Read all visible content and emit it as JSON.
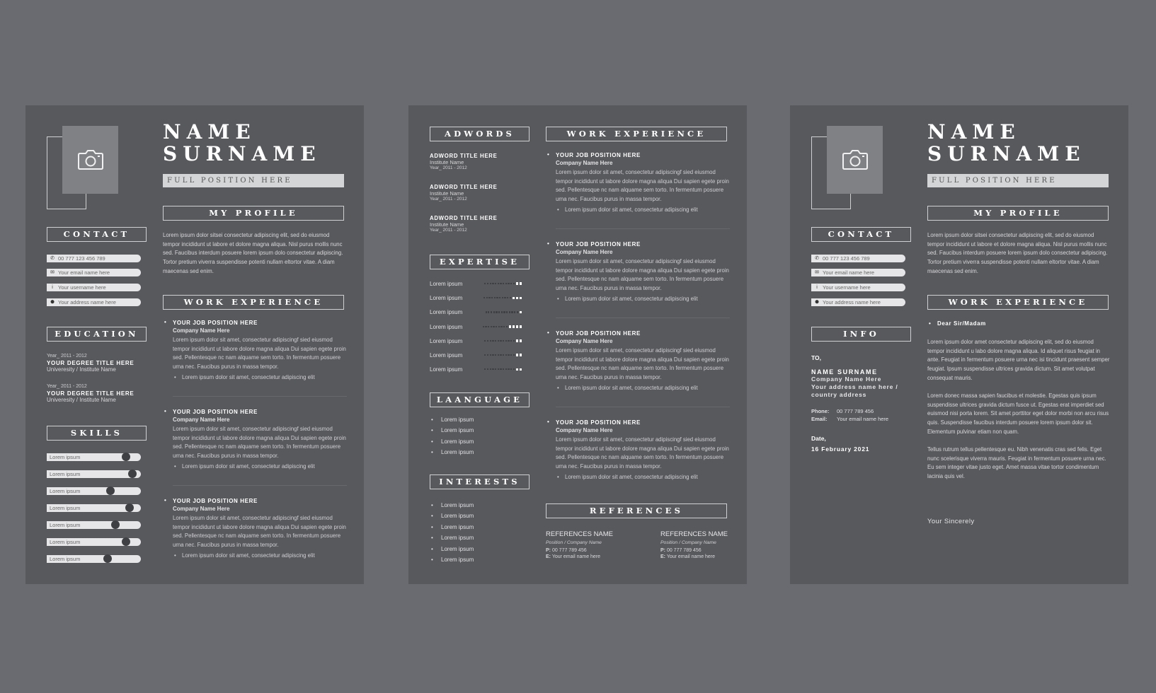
{
  "colors": {
    "background": "#6a6b70",
    "page": "#58595d",
    "photo": "#808184",
    "accent_light": "#d4d5d7"
  },
  "resume1": {
    "name_line1": "NAME",
    "name_line2": "SURNAME",
    "position": "FULL POSITION HERE",
    "contact_heading": "CONTACT",
    "contact": [
      {
        "icon": "phone-icon",
        "glyph": "✆",
        "text": "00 777 123 456 789"
      },
      {
        "icon": "email-icon",
        "glyph": "✉",
        "text": "Your email name here"
      },
      {
        "icon": "user-icon",
        "glyph": "i",
        "text": "Your username here"
      },
      {
        "icon": "location-icon",
        "glyph": "⬤",
        "text": "Your address name here"
      }
    ],
    "education_heading": "EDUCATION",
    "education": [
      {
        "year": "Year_ 2011 - 2012",
        "degree": "YOUR DEGREE TITLE HERE",
        "institute": "Univeresity / Institute Name"
      },
      {
        "year": "Year_ 2011 - 2012",
        "degree": "YOUR DEGREE TITLE HERE",
        "institute": "Univeresity / Institute Name"
      }
    ],
    "skills_heading": "SKILLS",
    "skills": [
      {
        "label": "Lorem ipsum",
        "level": 0.84
      },
      {
        "label": "Lorem ipsum",
        "level": 0.91
      },
      {
        "label": "Lorem ipsum",
        "level": 0.68
      },
      {
        "label": "Lorem ipsum",
        "level": 0.88
      },
      {
        "label": "Lorem ipsum",
        "level": 0.73
      },
      {
        "label": "Lorem ipsum",
        "level": 0.84
      },
      {
        "label": "Lorem ipsum",
        "level": 0.65
      }
    ],
    "profile_heading": "MY PROFILE",
    "profile_text": "Lorem ipsum dolor sitsei consectetur adipiscing elit, sed do eiusmod tempor incididunt ut labore et dolore magna aliqua. Nisl purus mollis nunc sed. Faucibus interdum posuere lorem ipsum dolo consectetur adipiscing. Tortor pretium viverra suspendisse potenti nullam eltortor vitae. A diam maecenas sed enim.",
    "work_heading": "WORK EXPERIENCE",
    "jobs": [
      {
        "title": "YOUR JOB POSITION HERE",
        "company": "Company Name Here",
        "desc": "Lorem ipsum dolor sit amet, consectetur adipiscingf sied eiusmod tempor incididunt ut labore dolore magna aliqua Dui sapien egete proin sed. Pellentesque nc nam alquame sem torto. In fermentum posuere urna nec. Faucibus purus in massa tempor.",
        "bullet": "Lorem ipsum dolor sit amet, consectetur adipiscing elit"
      },
      {
        "title": "YOUR JOB POSITION HERE",
        "company": "Company Name Here",
        "desc": "Lorem ipsum dolor sit amet, consectetur adipiscingf sied eiusmod tempor incididunt ut labore dolore magna aliqua Dui sapien egete proin sed. Pellentesque nc nam alquame sem torto. In fermentum posuere urna nec. Faucibus purus in massa tempor.",
        "bullet": "Lorem ipsum dolor sit amet, consectetur adipiscing elit"
      },
      {
        "title": "YOUR JOB POSITION HERE",
        "company": "Company Name Here",
        "desc": "Lorem ipsum dolor sit amet, consectetur adipiscingf sied eiusmod tempor incididunt ut labore dolore magna aliqua Dui sapien egete proin sed. Pellentesque nc nam alquame sem torto. In fermentum posuere urna nec. Faucibus purus in massa tempor.",
        "bullet": "Lorem ipsum dolor sit amet, consectetur adipiscing elit"
      }
    ]
  },
  "resume2": {
    "adwords_heading": "ADWORDS",
    "adwords": [
      {
        "title": "ADWORD TITLE HERE",
        "institute": "Institute Name",
        "year": "Year_ 2011 - 2012"
      },
      {
        "title": "ADWORD TITLE HERE",
        "institute": "Institute Name",
        "year": "Year_ 2011 - 2012"
      },
      {
        "title": "ADWORD TITLE HERE",
        "institute": "Institute Name",
        "year": "Year_ 2011 - 2012"
      }
    ],
    "expertise_heading": "EXPERTISE",
    "expertise": [
      {
        "label": "Lorem ipsum",
        "filled_dots": 2
      },
      {
        "label": "Lorem ipsum",
        "filled_dots": 3
      },
      {
        "label": "Lorem ipsum",
        "filled_dots": 1
      },
      {
        "label": "Lorem ipsum",
        "filled_dots": 4
      },
      {
        "label": "Lorem ipsum",
        "filled_dots": 2
      },
      {
        "label": "Lorem ipsum",
        "filled_dots": 2
      },
      {
        "label": "Lorem ipsum",
        "filled_dots": 2
      }
    ],
    "language_heading": "LAANGUAGE",
    "languages": [
      "Lorem ipsum",
      "Lorem ipsum",
      "Lorem ipsum",
      "Lorem ipsum"
    ],
    "interests_heading": "INTERESTS",
    "interests": [
      "Lorem ipsum",
      "Lorem ipsum",
      "Lorem ipsum",
      "Lorem ipsum",
      "Lorem ipsum",
      "Lorem ipsum"
    ],
    "work_heading": "WORK EXPERIENCE",
    "jobs": [
      {
        "title": "YOUR JOB POSITION HERE",
        "company": "Company Name Here",
        "desc": "Lorem ipsum dolor sit amet, consectetur adipiscingf sied eiusmod tempor incididunt ut labore dolore magna aliqua Dui sapien egete proin sed. Pellentesque nc nam alquame sem torto. In fermentum posuere urna nec. Faucibus purus in massa tempor.",
        "bullet": "Lorem ipsum dolor sit amet, consectetur adipiscing elit"
      },
      {
        "title": "YOUR JOB POSITION HERE",
        "company": "Company Name Here",
        "desc": "Lorem ipsum dolor sit amet, consectetur adipiscingf sied eiusmod tempor incididunt ut labore dolore magna aliqua Dui sapien egete proin sed. Pellentesque nc nam alquame sem torto. In fermentum posuere urna nec. Faucibus purus in massa tempor.",
        "bullet": "Lorem ipsum dolor sit amet, consectetur adipiscing elit"
      },
      {
        "title": "YOUR JOB POSITION HERE",
        "company": "Company Name Here",
        "desc": "Lorem ipsum dolor sit amet, consectetur adipiscingf sied eiusmod tempor incididunt ut labore dolore magna aliqua Dui sapien egete proin sed. Pellentesque nc nam alquame sem torto. In fermentum posuere urna nec. Faucibus purus in massa tempor.",
        "bullet": "Lorem ipsum dolor sit amet, consectetur adipiscing elit"
      },
      {
        "title": "YOUR JOB POSITION HERE",
        "company": "Company Name Here",
        "desc": "Lorem ipsum dolor sit amet, consectetur adipiscingf sied eiusmod tempor incididunt ut labore dolore magna aliqua Dui sapien egete proin sed. Pellentesque nc nam alquame sem torto. In fermentum posuere urna nec. Faucibus purus in massa tempor.",
        "bullet": "Lorem ipsum dolor sit amet, consectetur adipiscing elit"
      }
    ],
    "references_heading": "REFERENCES",
    "references": [
      {
        "name": "REFERENCES NAME",
        "position": "Position / Company Name",
        "phone_label": "P:",
        "phone": "00 777 789 456",
        "email_label": "E:",
        "email": "Your email name here"
      },
      {
        "name": "REFERENCES NAME",
        "position": "Position / Company Name",
        "phone_label": "P:",
        "phone": "00 777 789 456",
        "email_label": "E:",
        "email": "Your email name here"
      }
    ]
  },
  "letter": {
    "name_line1": "NAME",
    "name_line2": "SURNAME",
    "position": "FULL POSITION HERE",
    "contact_heading": "CONTACT",
    "contact": [
      {
        "icon": "phone-icon",
        "glyph": "✆",
        "text": "00 777 123 456 789"
      },
      {
        "icon": "email-icon",
        "glyph": "✉",
        "text": "Your email name here"
      },
      {
        "icon": "user-icon",
        "glyph": "i",
        "text": "Your username here"
      },
      {
        "icon": "location-icon",
        "glyph": "⬤",
        "text": "Your address name here"
      }
    ],
    "info_heading": "INFO",
    "to_label": "TO,",
    "recipient_name": "NAME SURNAME",
    "recipient_company": "Company Name Here",
    "recipient_address": "Your address name here / country address",
    "phone_label": "Phone:",
    "phone": "00 777 789 456",
    "email_label": "Email:",
    "email": "Your email name here",
    "date_label": "Date,",
    "date": "16 February 2021",
    "profile_heading": "MY PROFILE",
    "profile_text": "Lorem ipsum dolor sitsei consectetur adipiscing elit, sed do eiusmod tempor incididunt ut labore et dolore magna aliqua. Nisl purus mollis nunc sed. Faucibus interdum posuere lorem ipsum dolo consectetur adipiscing. Tortor pretium viverra suspendisse potenti nullam eltortor vitae. A diam maecenas sed enim.",
    "work_heading": "WORK EXPERIENCE",
    "salutation": "Dear Sir/Madam",
    "paragraphs": [
      "Lorem ipsum dolor amet consectetur adipiscing elit, sed do eiusmod tempor incididunt u labo dolore magna aliqua. Id aliquet risus feugiat in ante. Feugiat in fermentum posuere urna nec isi tincidunt praesent semper feugiat. Ipsum suspendisse ultrices gravida dictum. Sit amet volutpat consequat mauris.",
      "Lorem donec massa sapien faucibus et molestie. Egestas quis ipsum suspendisse ultrices gravida dictum fusce ut. Egestas erat imperdiet sed euismod nisi porta lorem. Sit amet porttitor eget dolor morbi non arcu risus quis. Suspendisse faucibus interdum posuere lorem ipsum dolor sit. Elementum pulvinar etiam non quam.",
      "Tellus rutrum tellus pellentesque eu. Nibh venenatis cras sed felis. Eget nunc scelerisque viverra mauris. Feugiat in fermentum posuere urna nec. Eu sem integer vitae justo eget. Amet massa vitae tortor condimentum lacinia quis vel."
    ],
    "signoff": "Your Sincerely"
  }
}
